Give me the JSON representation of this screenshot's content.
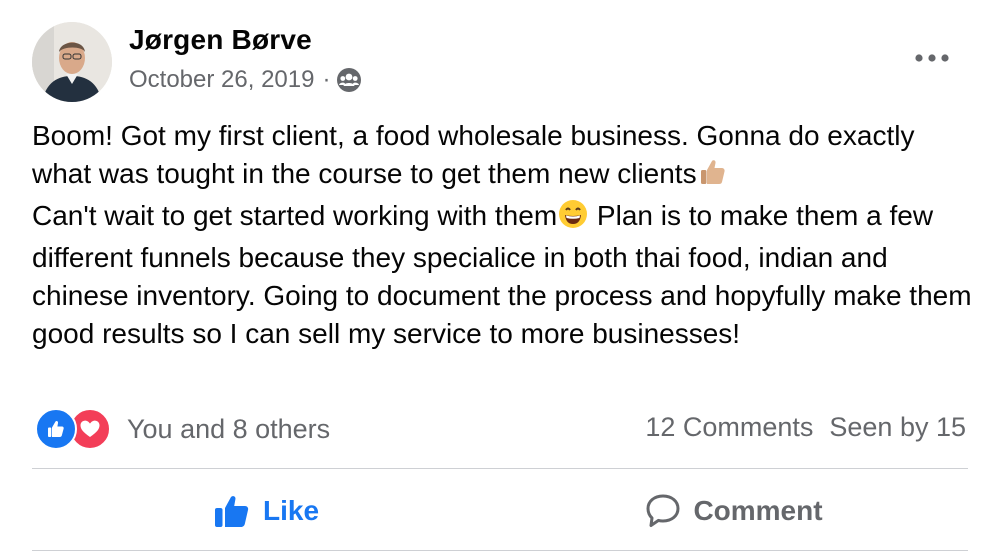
{
  "post": {
    "author": "Jørgen Børve",
    "date": "October 26, 2019",
    "separator": "·",
    "audience_icon": "group-icon",
    "more_icon": "more-horizontal-icon",
    "body": {
      "p1": "Boom! Got my first client, a food wholesale business. Gonna do exactly what was tought in the course to get them new clients",
      "emoji1": "👍🏼",
      "p2": "Can't wait to get started working with them",
      "emoji2": "😄",
      "p3": " Plan is to make them a few different funnels because they specialice in both thai food, indian and chinese inventory. Going to document the process and hopyfully make them good results so I can sell my service to more businesses!"
    }
  },
  "stats": {
    "reactors": "You and 8 others",
    "comments": "12 Comments",
    "seen": "Seen by 15"
  },
  "actions": {
    "like_label": "Like",
    "comment_label": "Comment"
  },
  "colors": {
    "like_blue": "#1877f2",
    "love_red": "#f33e58",
    "secondary_text": "#65676b"
  }
}
